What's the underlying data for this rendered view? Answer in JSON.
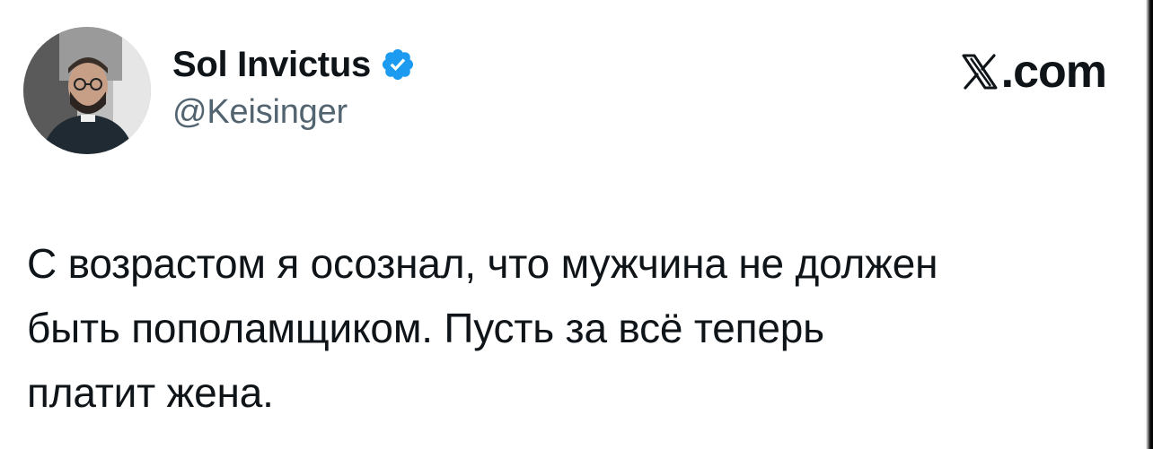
{
  "author": {
    "display_name": "Sol Invictus",
    "handle": "@Keisinger",
    "verified": true,
    "avatar_icon": "profile-photo"
  },
  "brand": {
    "text": ".com",
    "logo_icon": "x-logo-icon"
  },
  "tweet": {
    "lines": [
      "С возрастом я осознал, что мужчина не должен",
      "быть пополамщиком. Пусть за всё теперь",
      "платит жена."
    ]
  },
  "colors": {
    "text": "#0f1419",
    "secondary": "#536471",
    "verified": "#1d9bf0",
    "background": "#ffffff"
  }
}
